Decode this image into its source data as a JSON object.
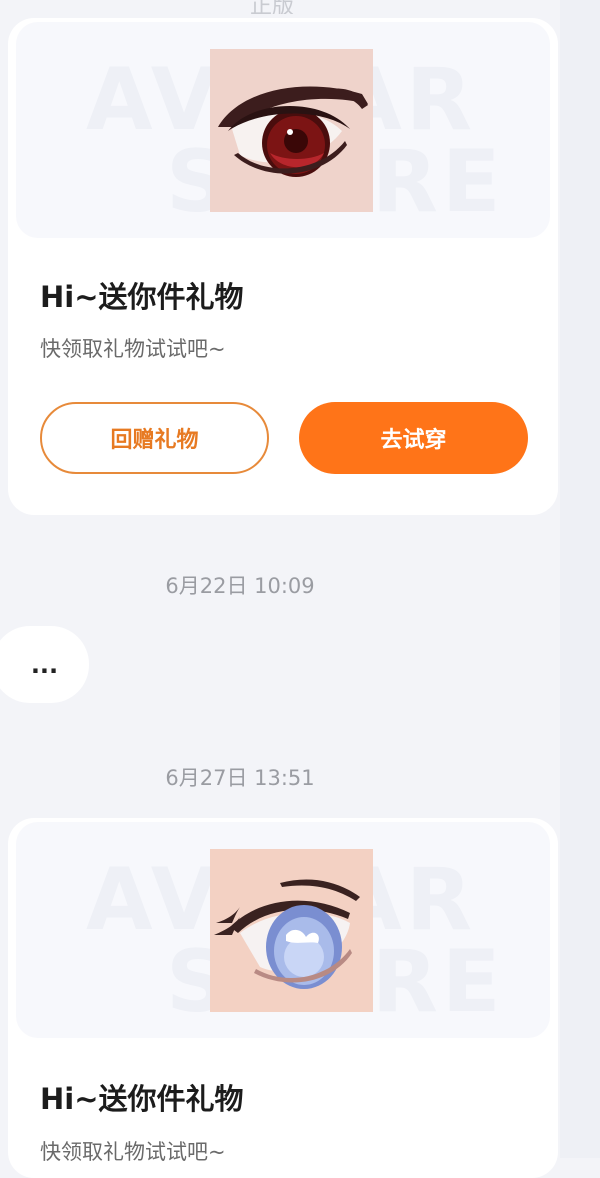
{
  "top": {
    "cut_text": "正版"
  },
  "cards": [
    {
      "title": "Hi~送你件礼物",
      "subtitle": "快领取礼物试试吧~",
      "watermark": "AVATAR",
      "watermark2": "STORE",
      "item_icon": "red-eye-icon",
      "return_label": "回赠礼物",
      "try_label": "去试穿"
    },
    {
      "title": "Hi~送你件礼物",
      "subtitle": "快领取礼物试试吧~",
      "watermark": "AVATAR",
      "watermark2": "STORE",
      "item_icon": "blue-eye-icon"
    }
  ],
  "timestamps": [
    "6月22日 10:09",
    "6月27日 13:51"
  ],
  "bubble": {
    "text": "..."
  },
  "colors": {
    "accent": "#ff7418",
    "outline": "#e78a3a",
    "background": "#f3f4f8"
  }
}
